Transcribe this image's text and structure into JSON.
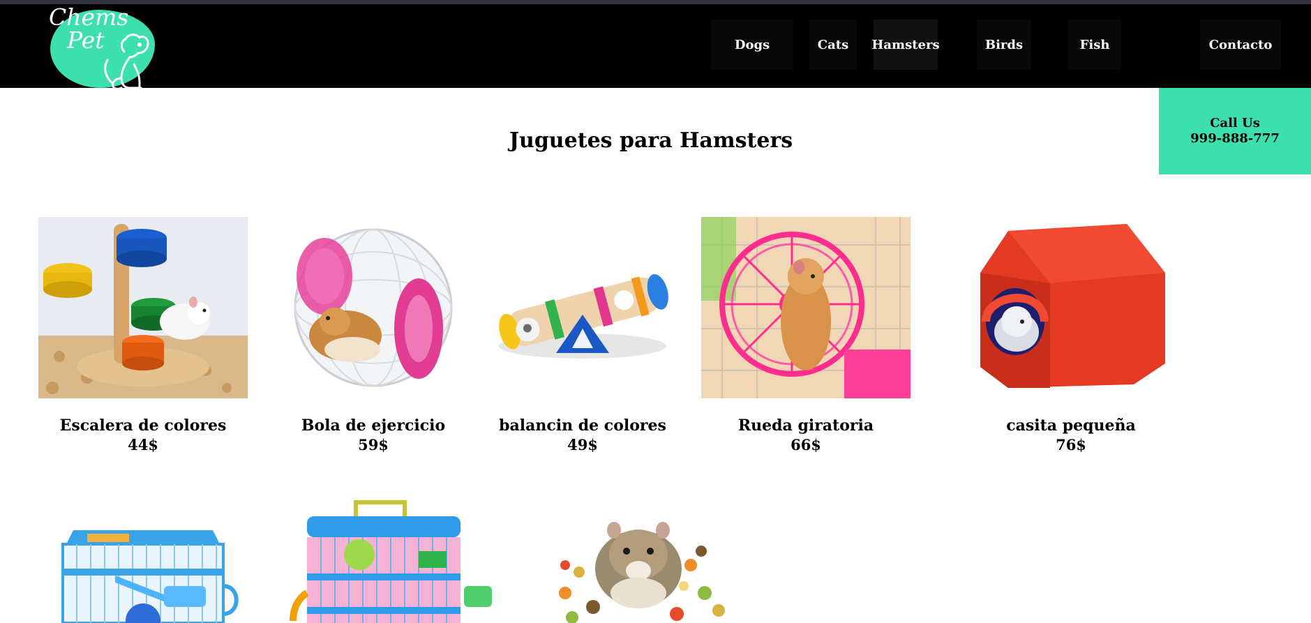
{
  "brand": {
    "name_line1": "Chems",
    "name_line2": "Pet"
  },
  "nav": {
    "items": [
      {
        "label": "Dogs"
      },
      {
        "label": "Cats"
      },
      {
        "label": "Hamsters"
      },
      {
        "label": "Birds"
      },
      {
        "label": "Fish"
      },
      {
        "label": "Contacto"
      }
    ],
    "active": "Hamsters"
  },
  "call": {
    "title": "Call Us",
    "phone": "999-888-777"
  },
  "page": {
    "title": "Juguetes para Hamsters"
  },
  "products": [
    {
      "name": "Escalera de colores",
      "price": "44$"
    },
    {
      "name": "Bola de ejercicio",
      "price": "59$"
    },
    {
      "name": "balancin de colores",
      "price": "49$"
    },
    {
      "name": "Rueda giratoria",
      "price": "66$"
    },
    {
      "name": "casita pequeña",
      "price": "76$"
    },
    {
      "name": "",
      "price": ""
    },
    {
      "name": "",
      "price": ""
    },
    {
      "name": "",
      "price": ""
    }
  ],
  "colors": {
    "accent": "#3ce0ad",
    "header": "#000000",
    "topstrip": "#2f3440"
  }
}
